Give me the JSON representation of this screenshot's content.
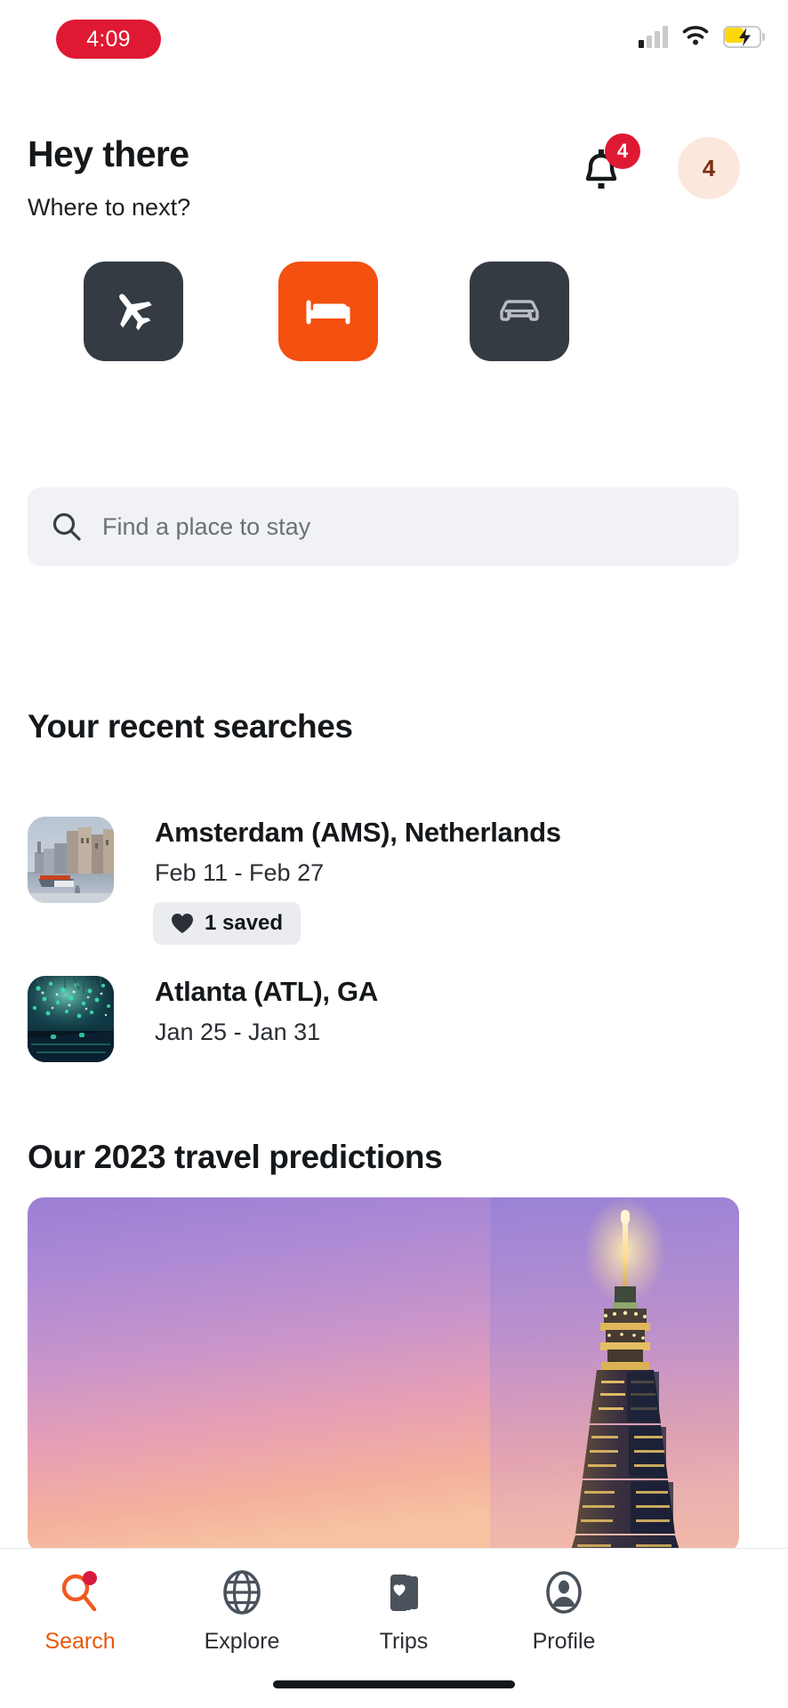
{
  "status_bar": {
    "recording_time": "4:09",
    "signal_icon": "cellular-signal-icon",
    "wifi_icon": "wifi-icon",
    "battery_icon": "battery-charging-icon"
  },
  "header": {
    "greeting": "Hey there",
    "subgreeting": "Where to next?",
    "notification_icon": "bell-icon",
    "notification_count": "4",
    "avatar_initial": "4"
  },
  "categories": [
    {
      "name": "flights",
      "icon": "airplane-icon",
      "color": "#343B43",
      "active": false
    },
    {
      "name": "hotels",
      "icon": "bed-icon",
      "color": "#F4500F",
      "active": true
    },
    {
      "name": "cars",
      "icon": "car-icon",
      "color": "#343B43",
      "active": false
    }
  ],
  "search": {
    "icon": "search-icon",
    "placeholder": "Find a place to stay",
    "value": ""
  },
  "recent_searches": {
    "title": "Your recent searches",
    "items": [
      {
        "destination": "Amsterdam (AMS), Netherlands",
        "dates": "Feb 11 - Feb 27",
        "saved_label": "1 saved",
        "saved_icon": "heart-filled-icon",
        "thumbnail": "amsterdam-canal-thumbnail"
      },
      {
        "destination": "Atlanta (ATL), GA",
        "dates": "Jan 25 - Jan 31",
        "thumbnail": "atlanta-lights-thumbnail"
      }
    ]
  },
  "predictions": {
    "title": "Our 2023 travel predictions",
    "hero_image": "taipei-101-dusk-hero"
  },
  "bottom_nav": {
    "items": [
      {
        "label": "Search",
        "icon": "search-magnifier-icon",
        "active": true
      },
      {
        "label": "Explore",
        "icon": "globe-icon",
        "active": false
      },
      {
        "label": "Trips",
        "icon": "trips-cards-heart-icon",
        "active": false
      },
      {
        "label": "Profile",
        "icon": "person-circle-icon",
        "active": false
      }
    ]
  },
  "colors": {
    "accent_orange": "#F4500F",
    "active_nav": "#E8590C",
    "dark_tile": "#343B43",
    "badge_red": "#E01933",
    "avatar_bg": "#FCE7DC",
    "search_bg": "#F1F2F5"
  }
}
